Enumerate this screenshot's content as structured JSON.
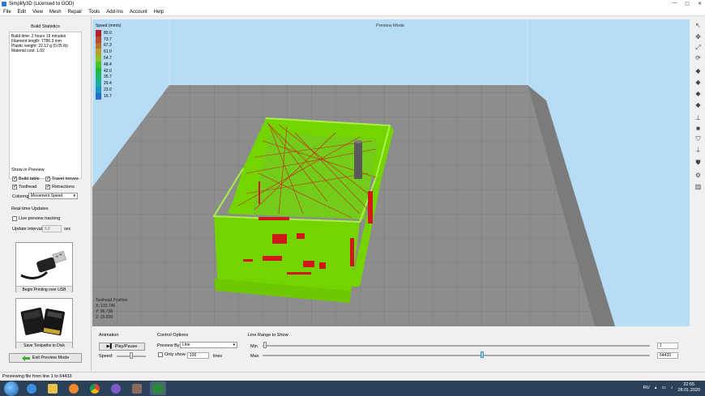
{
  "window": {
    "title": "Simplify3D (Licensed to GOD)",
    "min_glyph": "—",
    "max_glyph": "▢",
    "close_glyph": "✕"
  },
  "menu": [
    "File",
    "Edit",
    "View",
    "Mesh",
    "Repair",
    "Tools",
    "Add-Ins",
    "Account",
    "Help"
  ],
  "build_statistics": {
    "title": "Build Statistics",
    "lines": [
      "Build time: 2 hours 15 minutes",
      "Filament length: 7786.3 mm",
      "Plastic weight: 22.12 g (0.05 lb)",
      "Material cost: 1.02"
    ]
  },
  "show_in_preview": {
    "title": "Show in Preview",
    "build_table": {
      "label": "Build table",
      "checked": true
    },
    "travel_moves": {
      "label": "Travel moves",
      "checked": true
    },
    "toolhead": {
      "label": "Toolhead",
      "checked": true
    },
    "retractions": {
      "label": "Retractions",
      "checked": true
    },
    "coloring_label": "Coloring",
    "coloring_value": "Movement Speed"
  },
  "realtime": {
    "title": "Real-time Updates",
    "live_tracking": {
      "label": "Live preview tracking",
      "checked": false
    },
    "interval_label": "Update interval",
    "interval_value": "5.0",
    "interval_unit": "sec"
  },
  "usb_card": {
    "caption": "Begin Printing over USB"
  },
  "sd_card": {
    "caption": "Save Toolpaths to Disk"
  },
  "exit_preview": {
    "label": "Exit Preview Mode",
    "icon": "green-arrow-icon"
  },
  "viewport": {
    "mode_label": "Preview Mode",
    "toolhead_title": "Toolhead Position",
    "toolhead_x": "X: 122.746",
    "toolhead_y": "Y: 96.738",
    "toolhead_z": "Z: 29.600"
  },
  "speed_legend": {
    "title": "Speed (mm/s)",
    "entries": [
      {
        "value": "80.0",
        "color": "#b4202a"
      },
      {
        "value": "73.7",
        "color": "#b84a2d"
      },
      {
        "value": "67.3",
        "color": "#b9722c"
      },
      {
        "value": "61.0",
        "color": "#b6a02a"
      },
      {
        "value": "54.7",
        "color": "#8fbf28"
      },
      {
        "value": "48.4",
        "color": "#4fc02a"
      },
      {
        "value": "42.0",
        "color": "#22b93c"
      },
      {
        "value": "35.7",
        "color": "#1fb472"
      },
      {
        "value": "29.4",
        "color": "#1eaaa0"
      },
      {
        "value": "23.0",
        "color": "#1f93bf"
      },
      {
        "value": "16.7",
        "color": "#2270c6"
      }
    ]
  },
  "animation": {
    "title": "Animation",
    "play_label": "Play/Pause",
    "speed_label": "Speed:"
  },
  "control_options": {
    "title": "Control Options",
    "preview_by_label": "Preview By",
    "preview_by_value": "Line",
    "only_show_label": "Only show",
    "only_show_checked": false,
    "only_show_value": "100",
    "lines_label": "lines"
  },
  "line_range": {
    "title": "Line Range to Show",
    "min_label": "Min",
    "min_value": "1",
    "max_label": "Max",
    "max_value": "64433"
  },
  "status": {
    "text": "Previewing file from line 1 to 64433"
  },
  "taskbar": {
    "lang": "RU",
    "time": "22:55",
    "date": "28.01.2020"
  },
  "colors": {
    "model_green": "#7ee000",
    "extrusion_red": "#d01818",
    "bed_gray": "#8d8d8d",
    "viewport_sky": "#b7dcf6"
  }
}
